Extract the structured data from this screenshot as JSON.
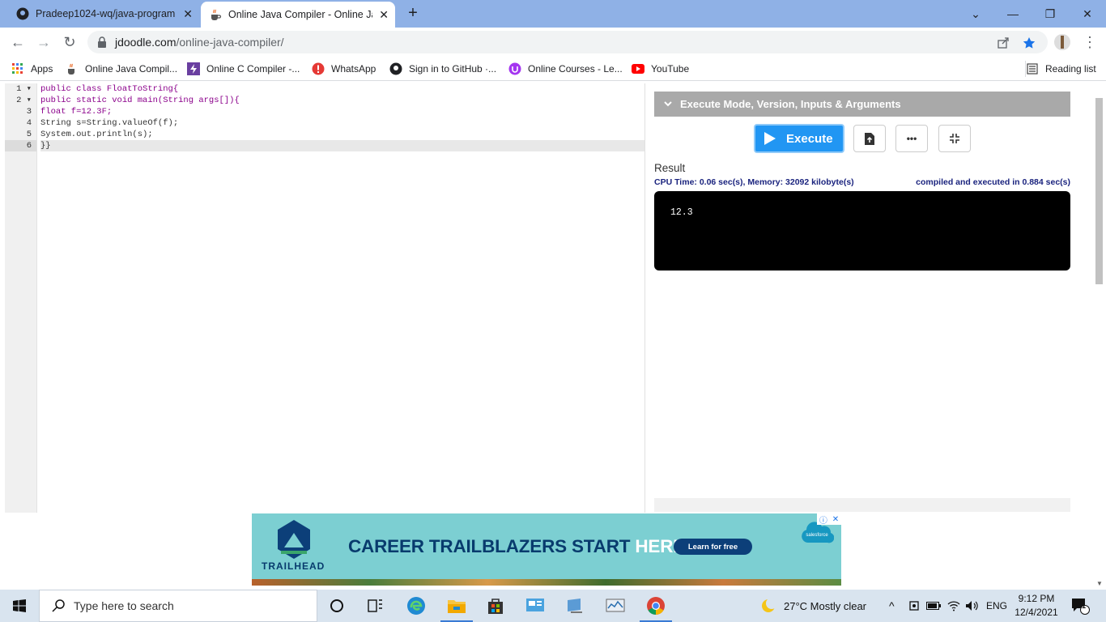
{
  "browser": {
    "tabs": [
      {
        "title": "Pradeep1024-wq/java-program"
      },
      {
        "title": "Online Java Compiler - Online Jav"
      }
    ],
    "new_tab": "+",
    "url_host": "jdoodle.com",
    "url_path": "/online-java-compiler/",
    "bookmarks": [
      {
        "label": "Apps"
      },
      {
        "label": "Online Java Compil..."
      },
      {
        "label": "Online C Compiler -..."
      },
      {
        "label": "WhatsApp"
      },
      {
        "label": "Sign in to GitHub ·..."
      },
      {
        "label": "Online Courses - Le..."
      },
      {
        "label": "YouTube"
      }
    ],
    "reading_list": "Reading list",
    "colors": {
      "titlebar": "#8fb1e6",
      "active_tab": "#ffffff"
    }
  },
  "editor": {
    "line_numbers": [
      "1 ▾",
      "2 ▾",
      "3",
      "4",
      "5",
      "6"
    ],
    "lines": [
      "public class FloatToString{",
      "public static void main(String args[]){",
      "float f=12.3F;",
      "String s=String.valueOf(f);",
      "System.out.println(s);",
      "}}"
    ]
  },
  "panel": {
    "header": "Execute Mode, Version, Inputs & Arguments",
    "execute_label": "Execute",
    "more_label": "•••",
    "result_title": "Result",
    "stats_left": "CPU Time: 0.06 sec(s), Memory: 32092 kilobyte(s)",
    "stats_right": "compiled and executed in 0.884 sec(s)",
    "output": "12.3",
    "colors": {
      "execute": "#2196f3",
      "header": "#a9a9a9",
      "stats": "#1a237e"
    }
  },
  "ad": {
    "headline_main": "CAREER TRAILBLAZERS START ",
    "headline_highlight": "HERE.",
    "cta": "Learn for free",
    "brand": "TRAILHEAD",
    "partner": "salesforce"
  },
  "taskbar": {
    "search_placeholder": "Type here to search",
    "weather": "27°C  Mostly clear",
    "language": "ENG",
    "time": "9:12 PM",
    "date": "12/4/2021",
    "notification_count": "1"
  }
}
